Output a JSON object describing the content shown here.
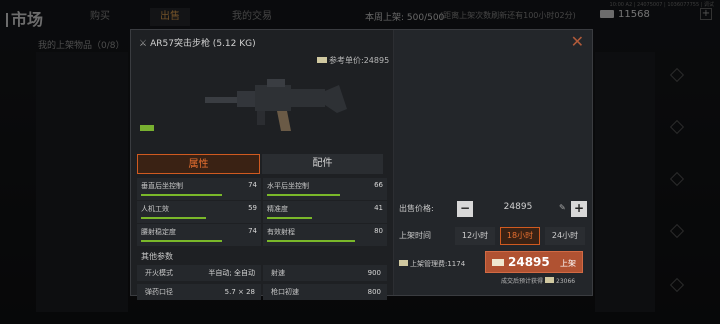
{
  "header": {
    "title": "市场",
    "tabs": [
      {
        "label": "购买"
      },
      {
        "label": "出售"
      },
      {
        "label": "我的交易"
      }
    ],
    "listing_status": "本周上架: 500/500",
    "note": "(距离上架次数刷新还有100小时02分)",
    "coins": "11568",
    "corner_meta": "10:00 A2 | 24075007 | 1036077755 | 调试"
  },
  "left_panel": {
    "label": "我的上架物品（0/8）"
  },
  "modal": {
    "title": "AR57突击步枪 (5.12 KG)",
    "reference_price_label": "参考单价:",
    "reference_price": "24895",
    "tabs": [
      {
        "label": "属性"
      },
      {
        "label": "配件"
      }
    ],
    "stats": [
      {
        "label": "垂直后坐控制",
        "value": "74",
        "fraction": 0.74
      },
      {
        "label": "水平后坐控制",
        "value": "66",
        "fraction": 0.66
      },
      {
        "label": "人机工效",
        "value": "59",
        "fraction": 0.59
      },
      {
        "label": "精准度",
        "value": "41",
        "fraction": 0.41
      },
      {
        "label": "腰射稳定度",
        "value": "74",
        "fraction": 0.74
      },
      {
        "label": "有效射程",
        "value": "80",
        "fraction": 0.8
      }
    ],
    "other_params_title": "其他参数",
    "params": [
      {
        "label": "开火模式",
        "value": "半自动; 全自动"
      },
      {
        "label": "射速",
        "value": "900"
      },
      {
        "label": "弹药口径",
        "value": "5.7 × 28"
      },
      {
        "label": "枪口初速",
        "value": "800"
      }
    ],
    "sale": {
      "price_label": "出售价格:",
      "price": "24895",
      "duration_label": "上架时间",
      "durations": [
        {
          "label": "12小时"
        },
        {
          "label": "18小时"
        },
        {
          "label": "24小时"
        }
      ],
      "selected_duration": "18小时",
      "fee": "上架管理费:1174",
      "list_amount": "24895",
      "list_label": "上架",
      "expected_label": "成交后预计获得",
      "expected_amount": "23066"
    },
    "colors": {
      "accent": "#e87030",
      "bar": "#7ab82a",
      "list_button": "#b05232"
    }
  }
}
